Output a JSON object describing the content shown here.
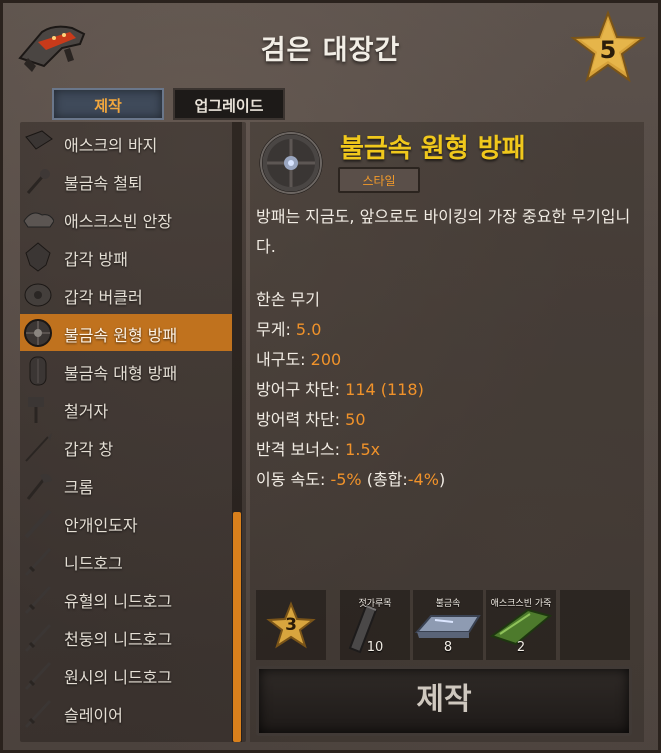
{
  "header": {
    "title": "검은 대장간",
    "station_level": "5",
    "station_icon": "forge-station-icon"
  },
  "tabs": [
    {
      "label": "제작"
    },
    {
      "label": "업그레이드"
    }
  ],
  "recipes": [
    {
      "label": "애스크의 바지",
      "icon": "trousers-icon"
    },
    {
      "label": "불금속 철퇴",
      "icon": "mace-icon"
    },
    {
      "label": "애스크스빈 안장",
      "icon": "saddle-icon"
    },
    {
      "label": "갑각 방패",
      "icon": "shield-icon"
    },
    {
      "label": "갑각 버클러",
      "icon": "buckler-icon"
    },
    {
      "label": "불금속 원형 방패",
      "icon": "round-shield-icon"
    },
    {
      "label": "불금속 대형 방패",
      "icon": "tower-shield-icon"
    },
    {
      "label": "철거자",
      "icon": "sledge-icon"
    },
    {
      "label": "갑각 창",
      "icon": "spear-icon"
    },
    {
      "label": "크롬",
      "icon": "axe-icon"
    },
    {
      "label": "안개인도자",
      "icon": "sword-icon"
    },
    {
      "label": "니드호그",
      "icon": "sword-icon"
    },
    {
      "label": "유혈의 니드호그",
      "icon": "sword-icon"
    },
    {
      "label": "천둥의 니드호그",
      "icon": "sword-icon"
    },
    {
      "label": "원시의 니드호그",
      "icon": "sword-icon"
    },
    {
      "label": "슬레이어",
      "icon": "sword-icon"
    }
  ],
  "selected_recipe_index": 5,
  "detail": {
    "name": "불금속 원형 방패",
    "style_button": "스타일",
    "description": "방패는 지금도, 앞으로도 바이킹의 가장 중요한 무기입니다.",
    "stats": {
      "hand": "한손 무기",
      "weight_label": "무게: ",
      "weight_value": "5.0",
      "durability_label": "내구도: ",
      "durability_value": "200",
      "block_label": "방어구 차단: ",
      "block_value": "114 (118)",
      "parry_label": "방어력 차단: ",
      "parry_value": "50",
      "parry_bonus_label": "반격 보너스: ",
      "parry_bonus_value": "1.5x",
      "move_label": "이동 속도: ",
      "move_value": "-5%",
      "move_total_open": " (총합:",
      "move_total_value": "-4%",
      "move_total_close": ")"
    }
  },
  "requirements": {
    "station_level": "3",
    "materials": [
      {
        "name": "젓가루목",
        "amount": "10",
        "icon": "wood-log-icon"
      },
      {
        "name": "불금속",
        "amount": "8",
        "icon": "metal-bar-icon"
      },
      {
        "name": "애스크스빈 가죽",
        "amount": "2",
        "icon": "hide-icon"
      }
    ]
  },
  "craft_button": "제작",
  "colors": {
    "accent": "#f0922a",
    "selected": "#c0721e",
    "title_gold": "#f0c81c"
  }
}
